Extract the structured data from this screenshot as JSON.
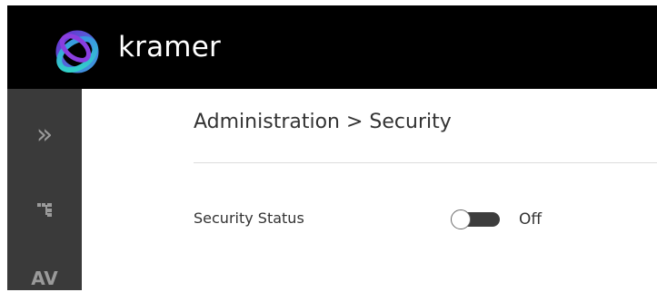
{
  "header": {
    "brand_name": "kramer",
    "logo_icon": "kramer-logo-icon",
    "background_color": "#000000"
  },
  "sidebar": {
    "background_color": "#3a3a3a",
    "items": [
      {
        "icon": "double-chevron-right-icon",
        "glyph": "»"
      },
      {
        "icon": "topology-icon"
      },
      {
        "icon": "av-icon",
        "label": "AV"
      }
    ]
  },
  "main": {
    "breadcrumb": "Administration > Security",
    "security_status": {
      "label": "Security Status",
      "enabled": false,
      "value_text": "Off"
    }
  }
}
